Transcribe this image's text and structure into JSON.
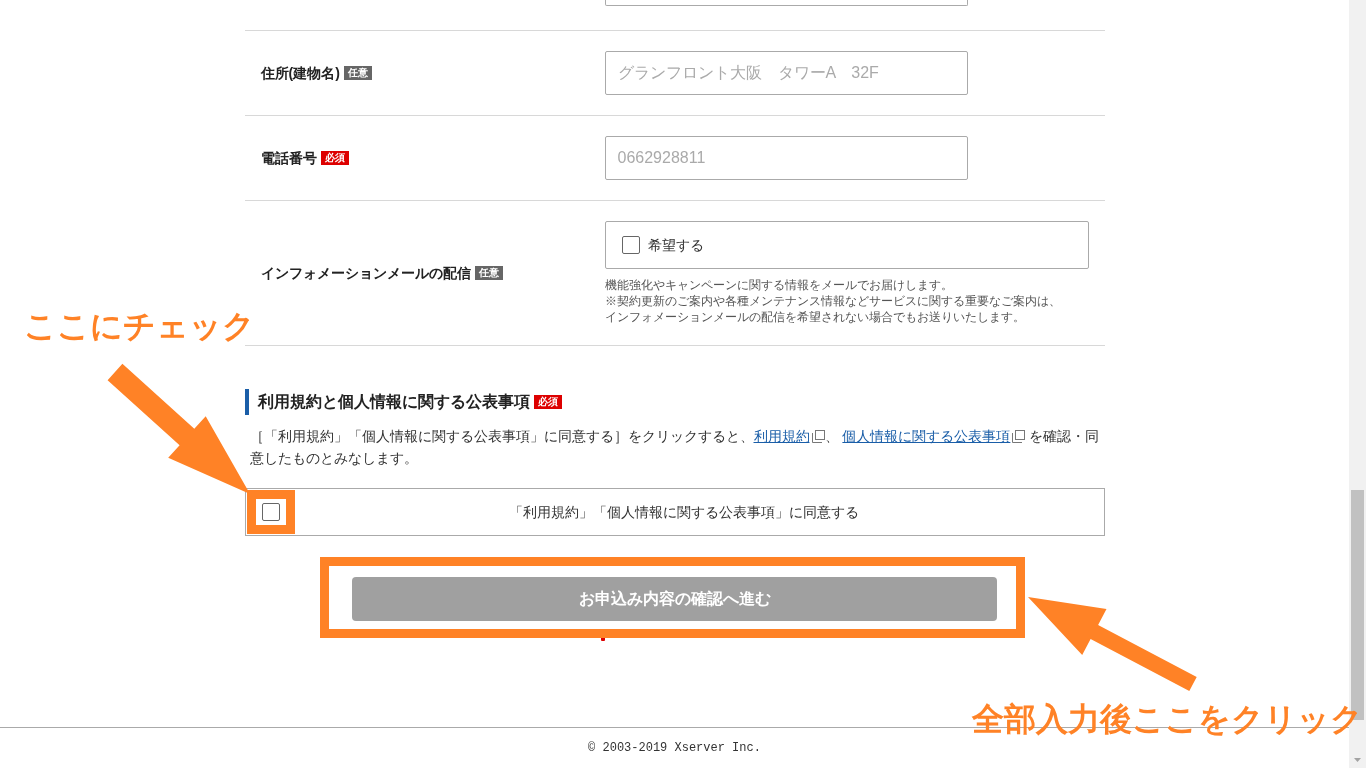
{
  "form_rows": [
    {
      "kind": "text",
      "label": "住所(建物名)",
      "badge": {
        "text": "任意",
        "kind": "optional"
      },
      "placeholder": "グランフロント大阪　タワーA　32F"
    },
    {
      "kind": "text",
      "label": "電話番号",
      "badge": {
        "text": "必須",
        "kind": "required"
      },
      "placeholder": "0662928811"
    },
    {
      "kind": "checkbox",
      "label": "インフォメーションメールの配信",
      "badge": {
        "text": "任意",
        "kind": "optional"
      },
      "option": {
        "label": "希望する",
        "checked": false
      },
      "notes": [
        "機能強化やキャンペーンに関する情報をメールでお届けします。",
        "※契約更新のご案内や各種メンテナンス情報などサービスに関する重要なご案内は、",
        "インフォメーションメールの配信を希望されない場合でもお送りいたします。"
      ]
    }
  ],
  "terms": {
    "heading": "利用規約と個人情報に関する公表事項",
    "badge": {
      "text": "必須",
      "kind": "required"
    },
    "description": [
      {
        "kind": "text",
        "text": "［「利用規約」「個人情報に関する公表事項」に同意する］をクリックすると、"
      },
      {
        "kind": "link",
        "text": "利用規約"
      },
      {
        "kind": "text",
        "text": "、 "
      },
      {
        "kind": "link",
        "text": "個人情報に関する公表事項"
      },
      {
        "kind": "text",
        "text": " を確認・同意したものとみなします。"
      }
    ],
    "agree": {
      "label": "「利用規約」「個人情報に関する公表事項」に同意する",
      "checked": false
    }
  },
  "submit": {
    "label": "お申込み内容の確認へ進む",
    "disabled": true
  },
  "footer": "© 2003-2019 Xserver Inc.",
  "annotations": [
    {
      "text": "ここにチェック"
    },
    {
      "text": "全部入力後ここをクリック"
    }
  ]
}
